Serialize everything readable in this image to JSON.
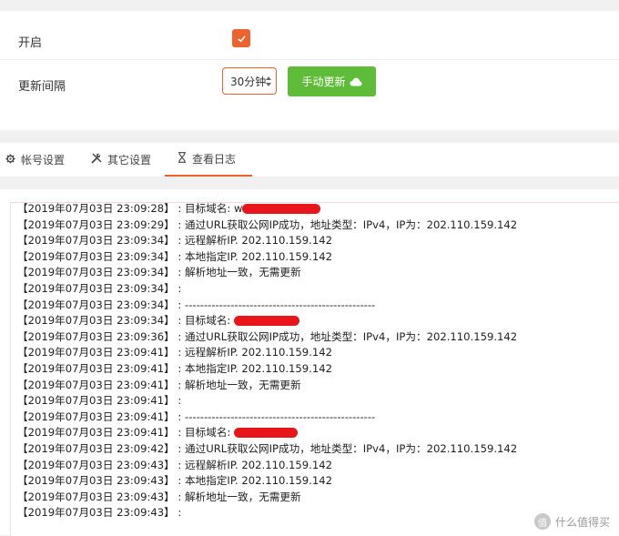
{
  "settings": {
    "enable_label": "开启",
    "enable_checked": true,
    "interval_label": "更新间隔",
    "interval_value": "30分钟",
    "update_button": "手动更新"
  },
  "tabs": [
    {
      "label": "帐号设置",
      "icon": "gear-icon",
      "active": false
    },
    {
      "label": "其它设置",
      "icon": "tools-icon",
      "active": false
    },
    {
      "label": "查看日志",
      "icon": "hourglass-icon",
      "active": true
    }
  ],
  "log": [
    {
      "ts": "【2019年07月03日 23:09:28】",
      "msg": "目标域名: w",
      "redact": 86
    },
    {
      "ts": "【2019年07月03日 23:09:29】",
      "msg": "通过URL获取公网IP成功，地址类型：IPv4，IP为：202.110.159.142",
      "redact": 0
    },
    {
      "ts": "【2019年07月03日 23:09:34】",
      "msg": "远程解析IP. 202.110.159.142",
      "redact": 0
    },
    {
      "ts": "【2019年07月03日 23:09:34】",
      "msg": "本地指定IP. 202.110.159.142",
      "redact": 0
    },
    {
      "ts": "【2019年07月03日 23:09:34】",
      "msg": "解析地址一致，无需更新",
      "redact": 0
    },
    {
      "ts": "【2019年07月03日 23:09:34】",
      "msg": "",
      "redact": 0
    },
    {
      "ts": "【2019年07月03日 23:09:34】",
      "msg": "--------------------------------------------------",
      "redact": 0
    },
    {
      "ts": "【2019年07月03日 23:09:34】",
      "msg": "目标域名: ",
      "redact": 72
    },
    {
      "ts": "【2019年07月03日 23:09:36】",
      "msg": "通过URL获取公网IP成功，地址类型：IPv4，IP为：202.110.159.142",
      "redact": 0
    },
    {
      "ts": "【2019年07月03日 23:09:41】",
      "msg": "远程解析IP. 202.110.159.142",
      "redact": 0
    },
    {
      "ts": "【2019年07月03日 23:09:41】",
      "msg": "本地指定IP. 202.110.159.142",
      "redact": 0
    },
    {
      "ts": "【2019年07月03日 23:09:41】",
      "msg": "解析地址一致，无需更新",
      "redact": 0
    },
    {
      "ts": "【2019年07月03日 23:09:41】",
      "msg": "",
      "redact": 0
    },
    {
      "ts": "【2019年07月03日 23:09:41】",
      "msg": "--------------------------------------------------",
      "redact": 0
    },
    {
      "ts": "【2019年07月03日 23:09:41】",
      "msg": "目标域名: ",
      "redact": 70
    },
    {
      "ts": "【2019年07月03日 23:09:42】",
      "msg": "通过URL获取公网IP成功，地址类型：IPv4，IP为：202.110.159.142",
      "redact": 0
    },
    {
      "ts": "【2019年07月03日 23:09:43】",
      "msg": "远程解析IP. 202.110.159.142",
      "redact": 0
    },
    {
      "ts": "【2019年07月03日 23:09:43】",
      "msg": "本地指定IP. 202.110.159.142",
      "redact": 0
    },
    {
      "ts": "【2019年07月03日 23:09:43】",
      "msg": "解析地址一致，无需更新",
      "redact": 0
    },
    {
      "ts": "【2019年07月03日 23:09:43】",
      "msg": "",
      "redact": 0
    }
  ],
  "watermark": "什么值得买",
  "watermark_glyph": "值",
  "colors": {
    "accent": "#f0622d",
    "button_green": "#5fbc38",
    "redaction": "#e8161a"
  }
}
